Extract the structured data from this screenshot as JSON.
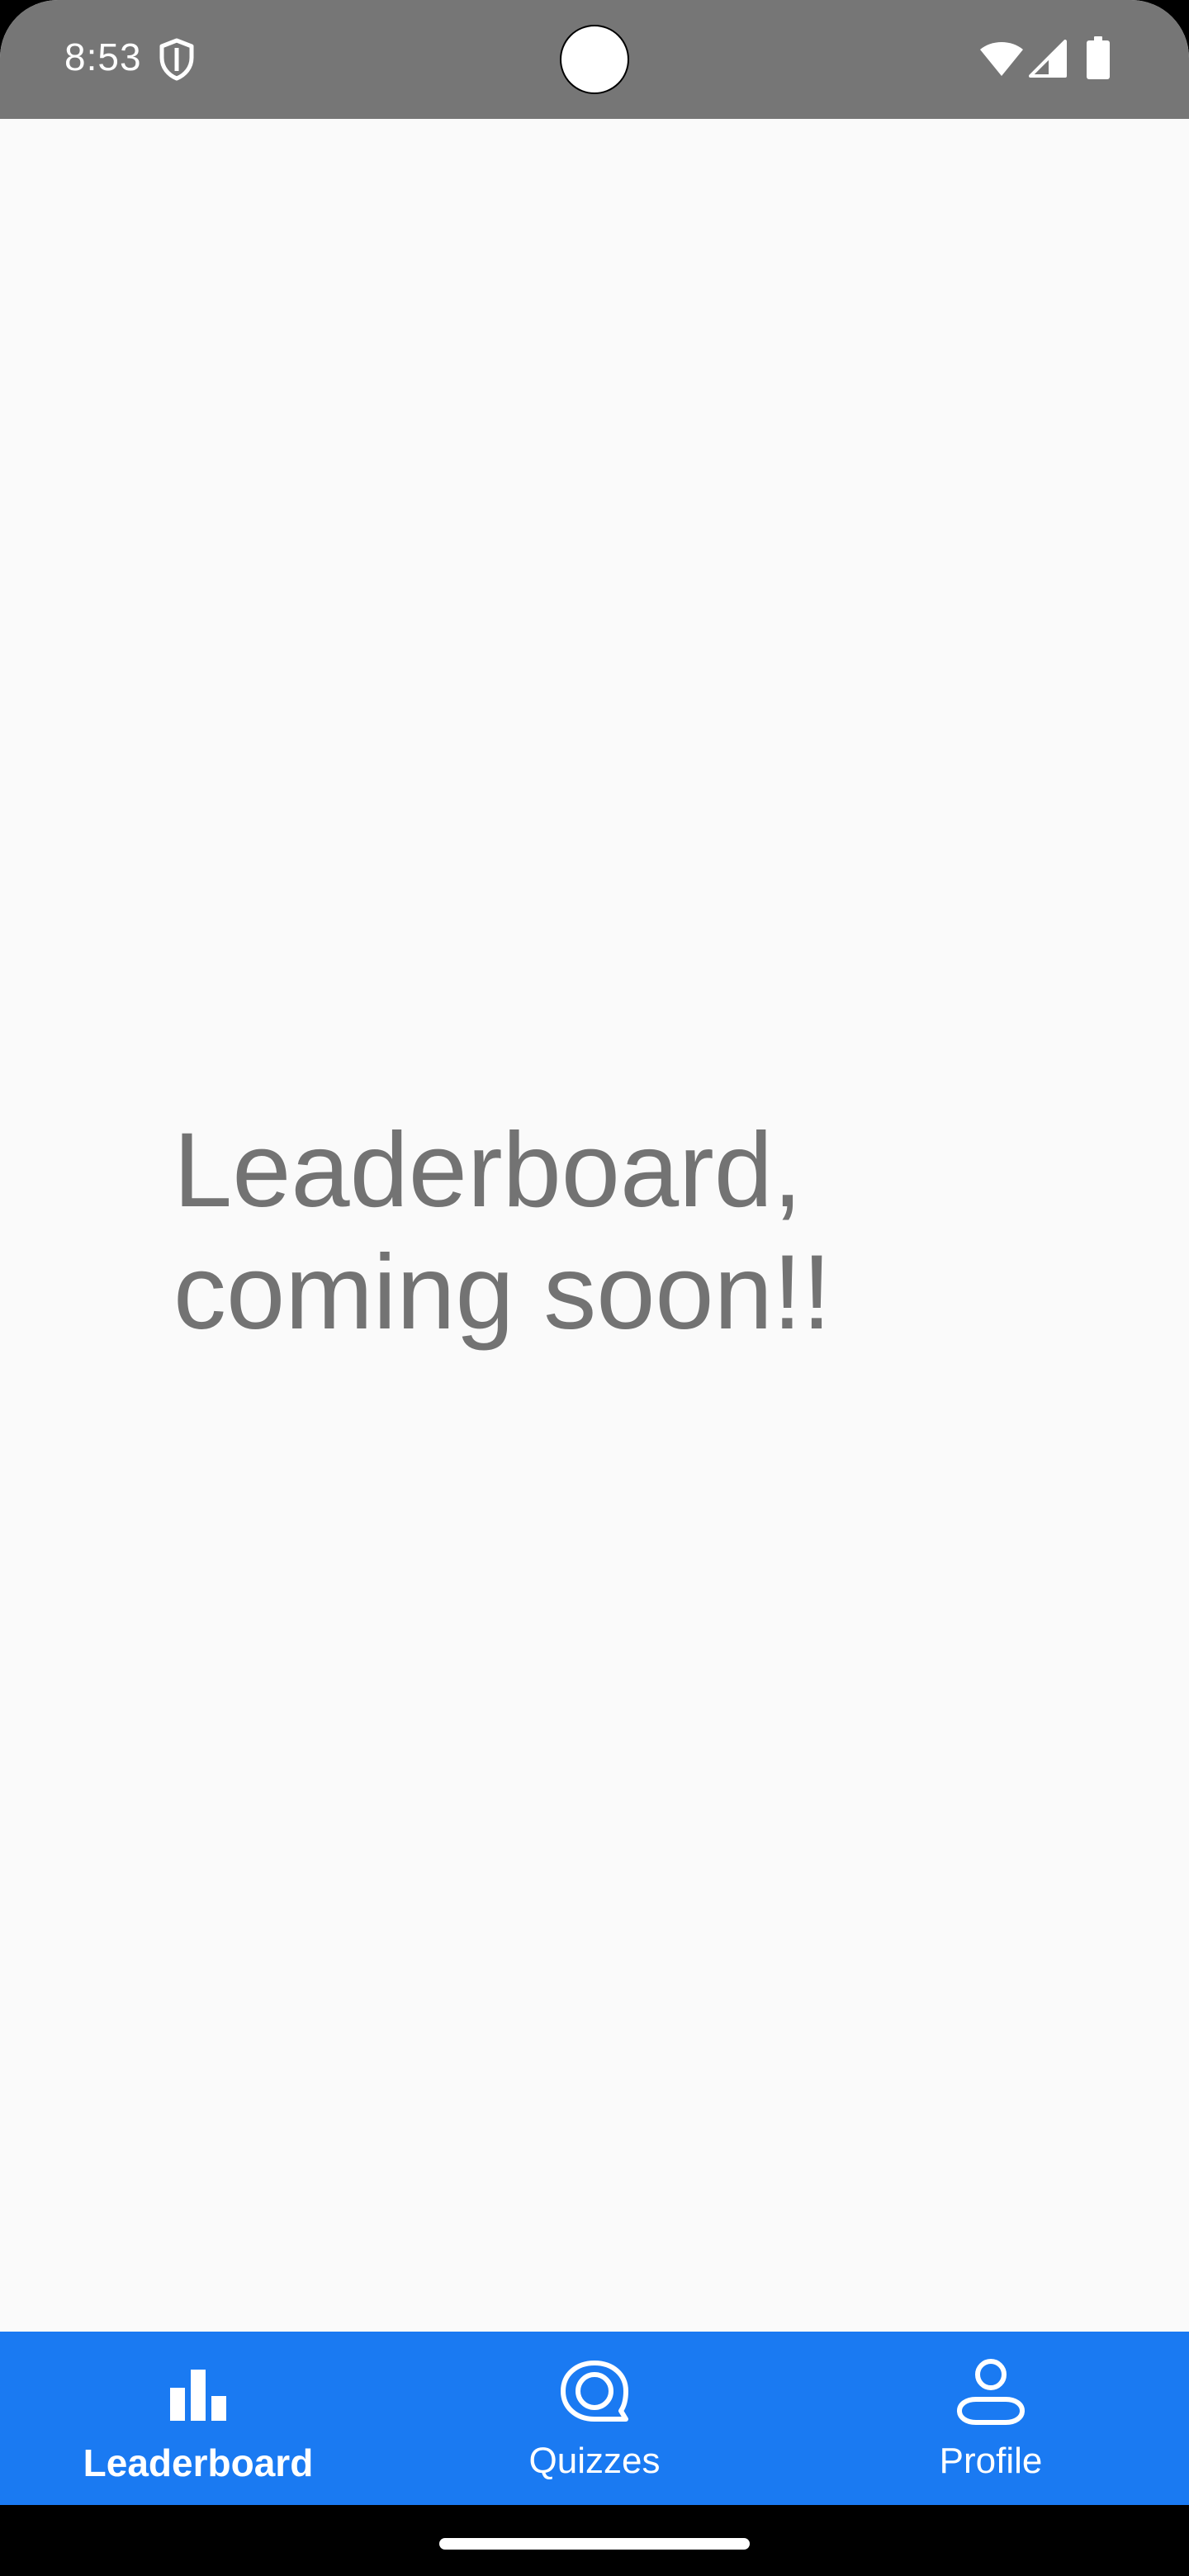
{
  "status_bar": {
    "time": "8:53",
    "icons": [
      "shield-icon",
      "wifi-icon",
      "cellular-signal-icon",
      "battery-icon"
    ],
    "background": "#767676"
  },
  "main": {
    "message_line1": "Leaderboard,",
    "message_line2": "coming soon!!",
    "text_color": "#737373",
    "background": "#fafafa"
  },
  "bottom_nav": {
    "background": "#1a7af2",
    "items": [
      {
        "label": "Leaderboard",
        "icon": "leaderboard-icon",
        "active": true
      },
      {
        "label": "Quizzes",
        "icon": "quizzes-icon",
        "active": false
      },
      {
        "label": "Profile",
        "icon": "profile-icon",
        "active": false
      }
    ]
  }
}
